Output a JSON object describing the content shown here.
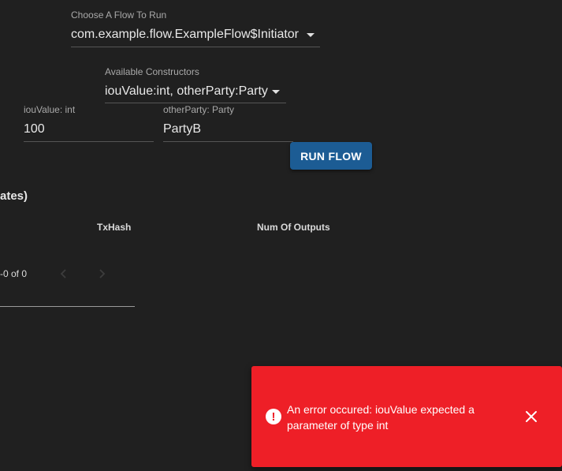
{
  "flow_selector": {
    "label": "Choose A Flow To Run",
    "value": "com.example.flow.ExampleFlow$Initiator"
  },
  "constructor_selector": {
    "label": "Available Constructors",
    "value": "iouValue:int, otherParty:Party"
  },
  "params": {
    "iou_value": {
      "label": "iouValue: int",
      "value": "100"
    },
    "other_party": {
      "label": "otherParty: Party",
      "value": "PartyB"
    }
  },
  "run_button": {
    "label": "RUN FLOW"
  },
  "section": {
    "title": "ates)"
  },
  "table": {
    "columns": [
      "TxHash",
      "Num Of Outputs"
    ]
  },
  "pagination": {
    "range": "-0 of 0"
  },
  "toast": {
    "message": "An error occured: iouValue expected a parameter of type int"
  },
  "colors": {
    "accent": "#1c5c94",
    "error": "#ee1f27",
    "background": "#202020"
  }
}
